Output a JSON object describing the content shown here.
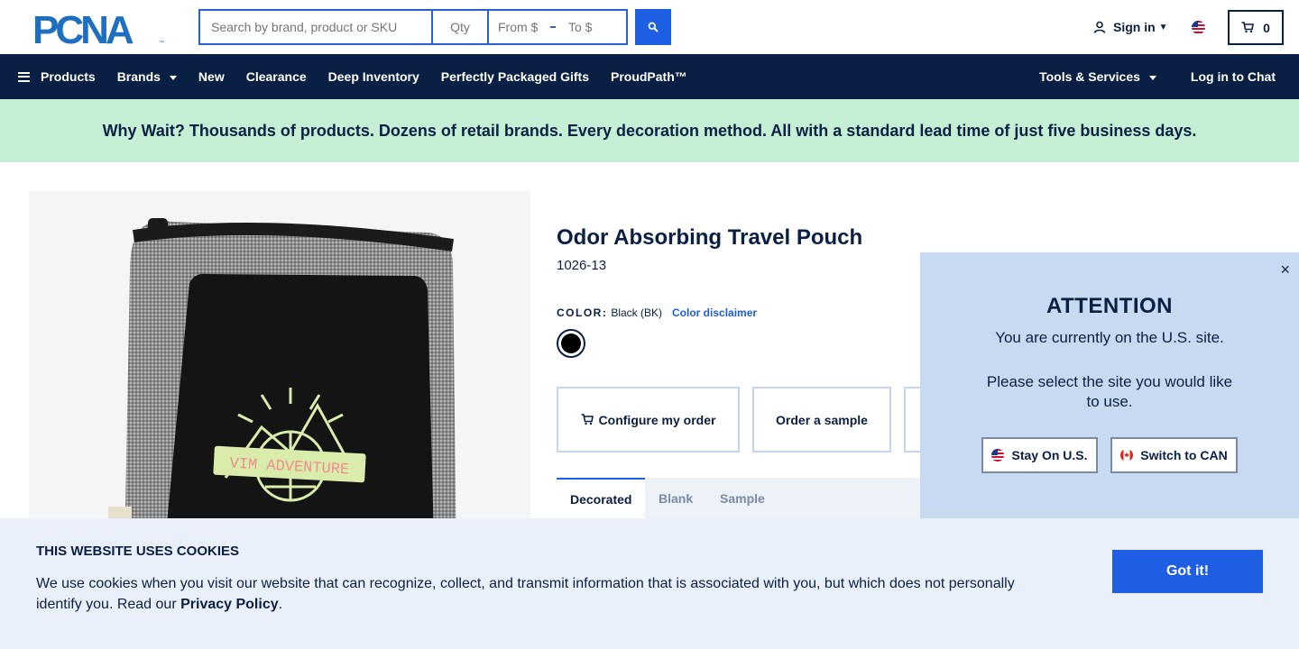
{
  "header": {
    "logo_text": "PCNA",
    "search_placeholder": "Search by brand, product or SKU",
    "qty_placeholder": "Qty",
    "price_from_placeholder": "From $",
    "price_to_placeholder": "To $",
    "signin_label": "Sign in",
    "cart_count": "0"
  },
  "nav": {
    "products": "Products",
    "brands": "Brands",
    "new": "New",
    "clearance": "Clearance",
    "deep_inventory": "Deep Inventory",
    "gifts": "Perfectly Packaged Gifts",
    "proudpath": "ProudPath™",
    "tools": "Tools & Services",
    "chat": "Log in to Chat"
  },
  "promo": {
    "text": "Why Wait? Thousands of products. Dozens of retail brands. Every decoration method. All with a standard lead time of just five business days."
  },
  "product": {
    "title": "Odor Absorbing Travel Pouch",
    "sku": "1026-13",
    "color_label": "COLOR:",
    "color_value": "Black (BK)",
    "color_disclaimer": "Color disclaimer",
    "swatch_color": "#000000",
    "image_text": "VIM ADVENTURE"
  },
  "actions": {
    "configure": "Configure my order",
    "sample": "Order a sample"
  },
  "tabs": {
    "decorated": "Decorated",
    "blank": "Blank",
    "sample": "Sample"
  },
  "modal": {
    "close": "×",
    "title": "ATTENTION",
    "line1": "You are currently on the U.S. site.",
    "line2": "Please select the site you would like to use.",
    "stay": "Stay On U.S.",
    "switch": "Switch to CAN"
  },
  "cookie": {
    "title": "THIS WEBSITE USES COOKIES",
    "text": "We use cookies when you visit our website that can recognize, collect, and transmit information that is associated with you, but which does not personally identify you. Read our ",
    "link": "Privacy Policy",
    "end": ".",
    "button": "Got it!"
  },
  "colors": {
    "navy": "#0a1f44",
    "accent_blue": "#1d5ee3",
    "promo_green": "#c5efd4",
    "modal_bg": "#c8daf1"
  }
}
